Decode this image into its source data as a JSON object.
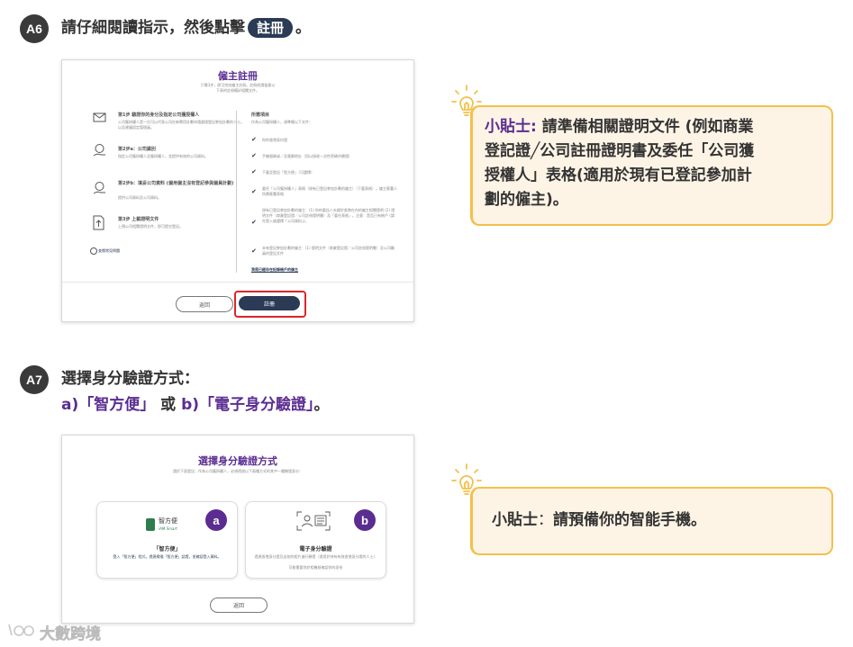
{
  "a6": {
    "badge": "A6",
    "instruction_prefix": "請仔細閱讀指示，然後點擊",
    "instruction_button": "註冊",
    "instruction_suffix": "。",
    "screen": {
      "title": "僱主註冊",
      "intro_line1": "只需3步，即可完成僱主註冊。註冊前請留意以",
      "intro_line2": "下表的註冊備好相關文件。",
      "steps": [
        {
          "title": "第1步 驗證你的身分及指定公司獲授權人",
          "desc": "公司獲授權人是一位可以代表公司在新聘用計劃申請處理登記參加計劃的人士。以及建議設定管理員。"
        },
        {
          "title": "第2步a：公司識別",
          "desc": "指定公司獲授權人及獲授權人，並提供有效的公司資料。"
        },
        {
          "title": "第2步b：填妥公司資料 (僱用僱主沒有登記參與僱員計劃)",
          "desc": "提供公司資料及公司資料。"
        },
        {
          "title": "第3步 上載證明文件",
          "desc": "上傳公司相關證明文件，即可提交登記。"
        }
      ],
      "help_link": "查閱常見問題",
      "required_title": "所需項目",
      "required_sub": "作為公司獲授權人，須準備以下文件：",
      "required_items": [
        "你的香港身份證",
        "手機號碼或／及電郵地址（用以接收一次性密碼作驗證）",
        "下載及登記「智方便」（可選擇）",
        "委任「公司獲授權人」表格（現有已登記參加計劃的僱主）（下載表格）。僱主簽署人所需簽署表格",
        "現有已登記參加計劃的僱主：(1) 你的委託人夫婦於香港在內的僱主相關證明 (2) 證明文件（商業登記證／公司註冊證明書）及「委任表格」。注意：是否已有帳戶 (請在登入後選擇「公司資料」)。",
        "未有登記參加計劃的僱主：(1) 證明文件（商業登記證／公司註冊證明書）及公司職員的登記文件"
      ],
      "bottom_link": "我是已經存在記錄帳戶的僱主",
      "back_label": "返回",
      "register_label": "註冊"
    }
  },
  "tip1": {
    "label": "小貼士:",
    "text_line1": "請準備相關證明文件 (例如商業",
    "text_line2": "登記證╱公司註冊證明書及委任「公司獲",
    "text_line3": "授權人」表格(適用於現有已登記參加計",
    "text_line4": "劃的僱主)。"
  },
  "a7": {
    "badge": "A7",
    "instruction_line1": "選擇身分驗證方式：",
    "instruction_a": "a)「智方便」",
    "instruction_or": "或",
    "instruction_b": "b)「電子身分驗證」",
    "instruction_end": "。",
    "screen": {
      "title": "選擇身分驗證方式",
      "subtitle": "請於下面登記，作為公司獲授權人，必須透過以下兩種方式的其中一種驗證身分：",
      "option_a": {
        "marker": "a",
        "logo_text": "智方便",
        "logo_sub": "iAM Smart",
        "title": "「智方便」",
        "desc": "登入「智方便」程式，透過掃描「智方便」認證，並確認登入資料。"
      },
      "option_b": {
        "marker": "b",
        "title": "電子身分驗證",
        "desc_line1": "透過香港身分證及自拍的相片進行驗證（適用於持有有效香港身分證的人士）",
        "desc_line2": "可能需要你於相機前確認你的身份"
      },
      "back_label": "返回"
    }
  },
  "tip2": {
    "label": "小貼士",
    "separator": "：",
    "text": "請預備你的智能手機。"
  },
  "watermark": {
    "text": "大數跨境"
  },
  "colors": {
    "accent_purple": "#5b2d91",
    "button_navy": "#2b3a55",
    "tip_border": "#f3c04a",
    "tip_bg": "#fef4e6",
    "highlight_red": "#d9262a"
  }
}
